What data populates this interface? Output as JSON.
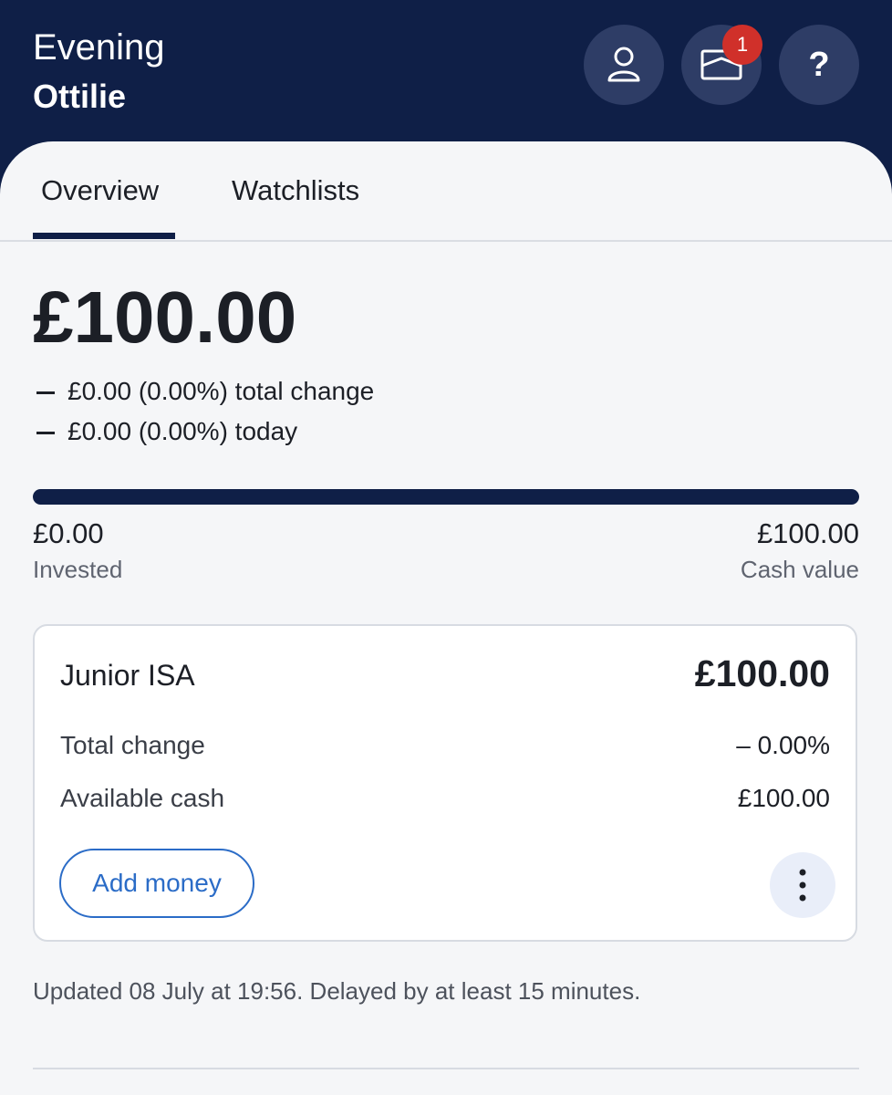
{
  "header": {
    "greeting": "Evening",
    "user_name": "Ottilie",
    "profile_icon": "user-icon",
    "messages_icon": "envelope-icon",
    "messages_badge": "1",
    "help_icon": "question-icon",
    "help_label": "?",
    "background_color": "#0f1f47",
    "badge_color": "#d0302a"
  },
  "tabs": [
    {
      "label": "Overview",
      "active": true
    },
    {
      "label": "Watchlists",
      "active": false
    }
  ],
  "overview": {
    "total_value": "£100.00",
    "total_change_value": "£0.00 (0.00%)",
    "total_change_label": "total change",
    "today_change_value": "£0.00 (0.00%)",
    "today_change_label": "today",
    "allocation": {
      "invested_fraction": 0.0,
      "invested_value": "£0.00",
      "invested_label": "Invested",
      "cash_value": "£100.00",
      "cash_label": "Cash value"
    }
  },
  "account_card": {
    "title": "Junior ISA",
    "amount": "£100.00",
    "rows": [
      {
        "label": "Total change",
        "value": "– 0.00%"
      },
      {
        "label": "Available cash",
        "value": "£100.00"
      }
    ],
    "add_money_label": "Add money",
    "more_icon": "more-vertical-icon",
    "accent_color": "#2b6cc7"
  },
  "footer": {
    "updated_text": "Updated 08 July at 19:56. Delayed by at least 15 minutes."
  }
}
